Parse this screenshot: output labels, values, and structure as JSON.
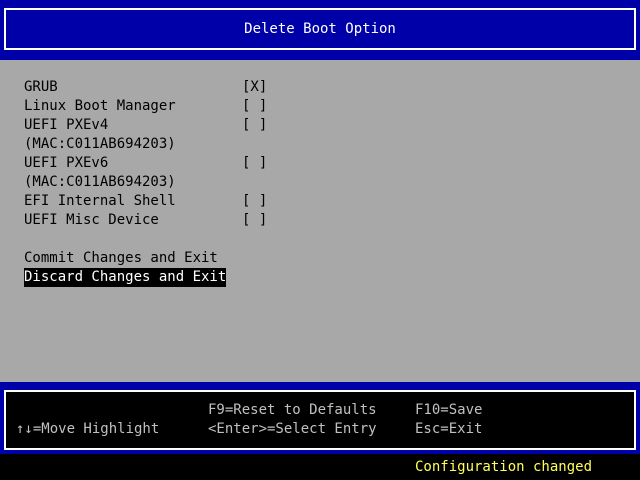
{
  "header": {
    "title": "Delete Boot Option"
  },
  "boot_options": [
    {
      "label": "GRUB",
      "checkbox": "[X]"
    },
    {
      "label": "Linux Boot Manager",
      "checkbox": "[ ]"
    },
    {
      "label": "UEFI PXEv4",
      "checkbox": "[ ]"
    },
    {
      "label": "(MAC:C011AB694203)"
    },
    {
      "label": "UEFI PXEv6",
      "checkbox": "[ ]"
    },
    {
      "label": "(MAC:C011AB694203)"
    },
    {
      "label": "EFI Internal Shell",
      "checkbox": "[ ]"
    },
    {
      "label": "UEFI Misc Device",
      "checkbox": "[ ]"
    }
  ],
  "actions": {
    "commit": "Commit Changes and Exit",
    "discard": "Discard Changes and Exit"
  },
  "footer": {
    "move_highlight": "↑↓=Move Highlight",
    "reset_defaults": "F9=Reset to Defaults",
    "select_entry": "<Enter>=Select Entry",
    "save": "F10=Save",
    "exit": "Esc=Exit"
  },
  "status": {
    "message": "Configuration changed"
  },
  "colors": {
    "background": "#a8a8a8",
    "header_blue": "#0000a8",
    "highlight": "#000000",
    "status_text": "#ffff55"
  }
}
